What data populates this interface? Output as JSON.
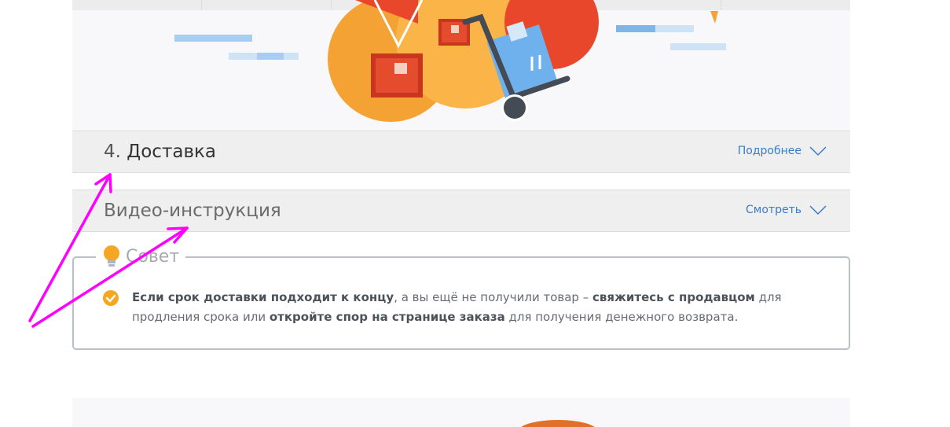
{
  "section_4": {
    "number": "4.",
    "title": "Доставка",
    "more_label": "Подробнее"
  },
  "video": {
    "title": "Видео-инструкция",
    "watch_label": "Смотреть"
  },
  "tip": {
    "legend": "Совет",
    "p1_bold": "Если срок доставки подходит к концу",
    "p2": ", а вы ещё не получили товар – ",
    "p3_bold": "свяжитесь с продавцом",
    "p4": " для продления срока или ",
    "p5_bold": "откройте спор на странице заказа",
    "p6": " для получения денежного возврата."
  },
  "colors": {
    "accent_link": "#3a7bc8",
    "annotation_arrow": "#ff00ff",
    "illustration_orange": "#f7a235",
    "illustration_red": "#e0402a",
    "illustration_blue": "#6fb1ec"
  },
  "icons": {
    "chevron": "chevron-down-icon",
    "bulb": "lightbulb-icon",
    "check": "check-circle-icon"
  }
}
